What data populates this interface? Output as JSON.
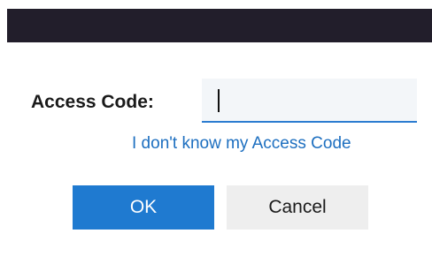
{
  "dialog": {
    "access_code_label": "Access Code:",
    "access_code_value": "",
    "help_link": "I don't know my Access Code",
    "ok_label": "OK",
    "cancel_label": "Cancel"
  },
  "colors": {
    "title_bar": "#221e2b",
    "accent": "#1f7ad0",
    "link": "#1d6fc0",
    "cancel_bg": "#eeeeee"
  }
}
